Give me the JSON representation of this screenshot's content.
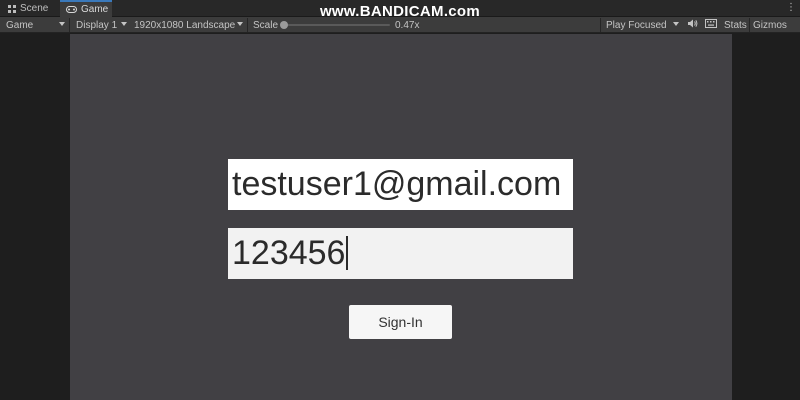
{
  "tabs": [
    {
      "label": "Scene",
      "icon": "grid-icon"
    },
    {
      "label": "Game",
      "icon": "gamepad-icon"
    }
  ],
  "watermark": "www.BANDICAM.com",
  "toolbar": {
    "view_mode": "Game",
    "display": "Display 1",
    "resolution": "1920x1080 Landscape",
    "scale_label": "Scale",
    "scale_value": "0.47x",
    "play_mode": "Play Focused",
    "stats": "Stats",
    "gizmos": "Gizmos"
  },
  "form": {
    "email_value": "testuser1@gmail.com",
    "password_value": "123456",
    "signin_label": "Sign-In"
  },
  "colors": {
    "canvas_background": "#414044",
    "input_background": "#ffffff",
    "tab_accent": "#3a79bb"
  }
}
